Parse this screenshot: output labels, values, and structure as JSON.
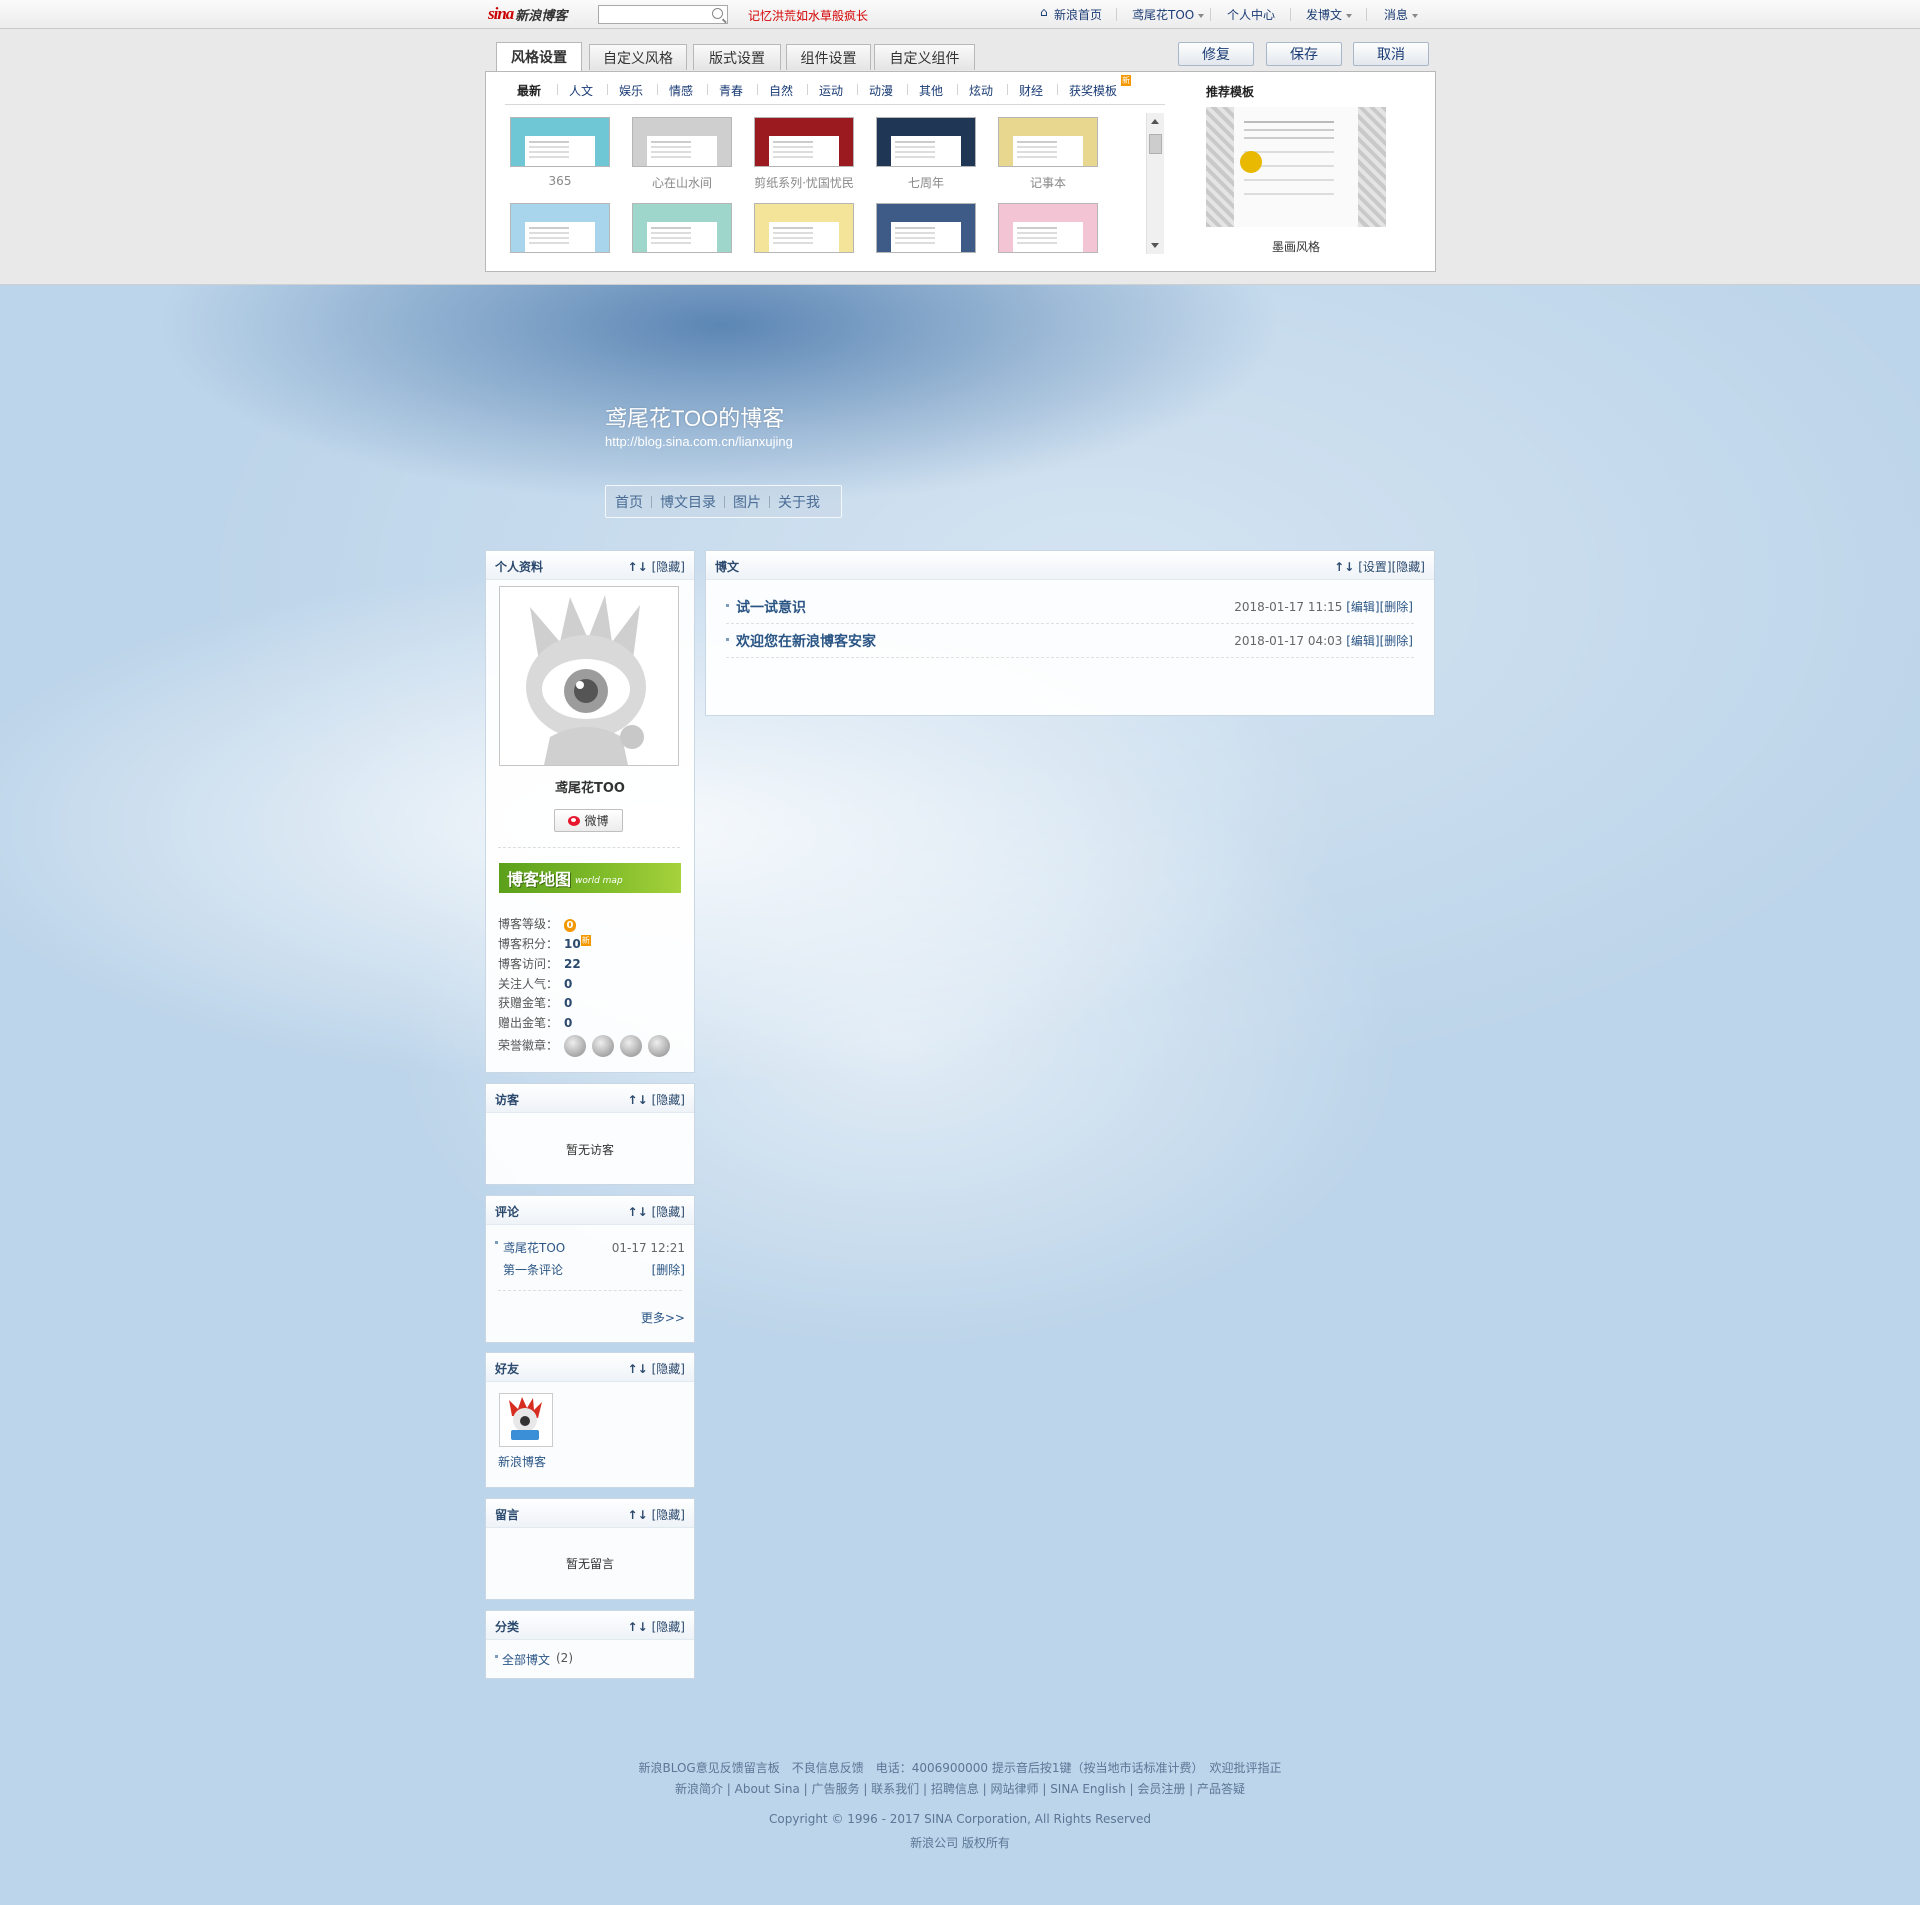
{
  "topbar": {
    "logo_sina": "sina",
    "logo_blog": "新浪博客",
    "search_placeholder": "",
    "news": "记忆洪荒如水草般疯长",
    "nav": [
      "新浪首页",
      "鸢尾花TOO",
      "个人中心",
      "发博文",
      "消息"
    ]
  },
  "settings": {
    "tabs": [
      "风格设置",
      "自定义风格",
      "版式设置",
      "组件设置",
      "自定义组件"
    ],
    "buttons": {
      "restore": "修复",
      "save": "保存",
      "cancel": "取消"
    },
    "categories": [
      "最新",
      "人文",
      "娱乐",
      "情感",
      "青春",
      "自然",
      "运动",
      "动漫",
      "其他",
      "炫动",
      "财经",
      "获奖模板"
    ],
    "new_badge": "新",
    "templates_row1": [
      {
        "label": "365",
        "color": "#6fc7d6"
      },
      {
        "label": "心在山水间",
        "color": "#cfcfcf"
      },
      {
        "label": "剪纸系列·忧国忧民",
        "color": "#9b1a1f"
      },
      {
        "label": "七周年",
        "color": "#1f3654"
      },
      {
        "label": "记事本",
        "color": "#e8d88f"
      }
    ],
    "templates_row2": [
      {
        "color": "#a8d4ec"
      },
      {
        "color": "#9ed6cc"
      },
      {
        "color": "#f3e49a"
      },
      {
        "color": "#3e5a86"
      },
      {
        "color": "#f2c4d4"
      }
    ],
    "recommend_title": "推荐模板",
    "recommend_label": "墨画风格"
  },
  "blog": {
    "title": "鸢尾花TOO的博客",
    "url": "http://blog.sina.com.cn/lianxujing",
    "nav": [
      "首页",
      "博文目录",
      "图片",
      "关于我"
    ]
  },
  "module_actions": {
    "arrows": "↑↓",
    "hide": "[隐藏]",
    "set": "[设置]"
  },
  "profile": {
    "title": "个人资料",
    "name": "鸢尾花TOO",
    "weibo": "微博",
    "map_title": "博客地图",
    "map_sub": "world map",
    "stats": [
      {
        "label": "博客等级：",
        "value": "0"
      },
      {
        "label": "博客积分：",
        "value": "10"
      },
      {
        "label": "博客访问：",
        "value": "22"
      },
      {
        "label": "关注人气：",
        "value": "0"
      },
      {
        "label": "获赠金笔：",
        "value": "0"
      },
      {
        "label": "赠出金笔：",
        "value": "0"
      },
      {
        "label": "荣誉徽章：",
        "value": ""
      }
    ]
  },
  "visitors": {
    "title": "访客",
    "empty": "暂无访客"
  },
  "comments": {
    "title": "评论",
    "items": [
      {
        "author": "鸢尾花TOO",
        "time": "01-17 12:21",
        "text": "第一条评论",
        "action": "[删除]"
      }
    ],
    "more": "更多>>"
  },
  "friends": {
    "title": "好友",
    "items": [
      {
        "name": "新浪博客"
      }
    ]
  },
  "messages": {
    "title": "留言",
    "empty": "暂无留言"
  },
  "categories": {
    "title": "分类",
    "items": [
      {
        "name": "全部博文",
        "count": "(2)"
      }
    ]
  },
  "posts": {
    "title": "博文",
    "items": [
      {
        "title": "试一试意识",
        "time": "2018-01-17 11:15",
        "edit": "[编辑]",
        "del": "[删除]"
      },
      {
        "title": "欢迎您在新浪博客安家",
        "time": "2018-01-17 04:03",
        "edit": "[编辑]",
        "del": "[删除]"
      }
    ]
  },
  "footer": {
    "line1": "新浪BLOG意见反馈留言板　不良信息反馈　电话：4006900000 提示音后按1键（按当地市话标准计费）　欢迎批评指正",
    "line2": "新浪简介 | About Sina | 广告服务 | 联系我们 | 招聘信息 | 网站律师 | SINA English | 会员注册 | 产品答疑",
    "line3": "Copyright © 1996 - 2017 SINA Corporation, All Rights Reserved",
    "line4": "新浪公司 版权所有"
  }
}
